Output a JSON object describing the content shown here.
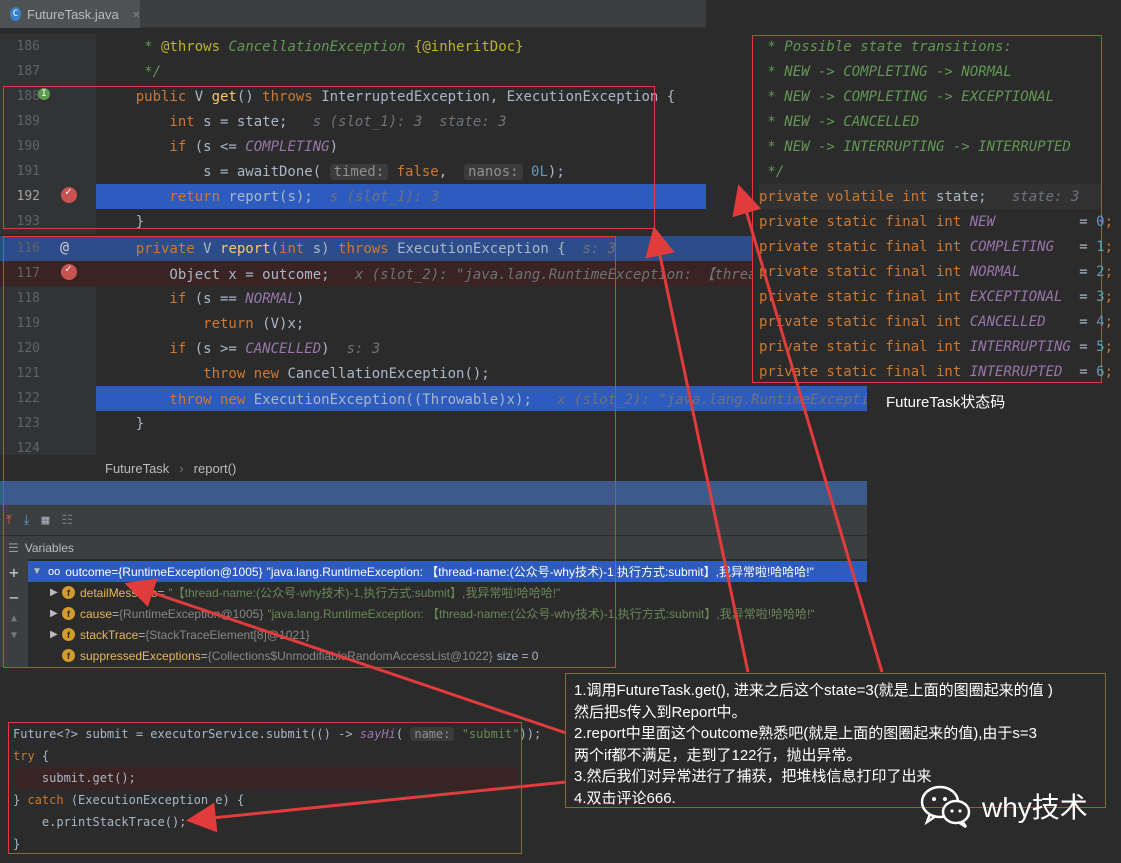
{
  "tab": {
    "filename": "FutureTask.java",
    "icon": "C"
  },
  "pane1": {
    "lines": [
      {
        "n": "186",
        "segs": [
          [
            "cm",
            "     * "
          ],
          [
            "ann",
            "@throws"
          ],
          [
            "cm",
            " CancellationException "
          ],
          [
            "ann",
            "{@inheritDoc}"
          ]
        ]
      },
      {
        "n": "187",
        "segs": [
          [
            "cm",
            "     */"
          ]
        ]
      },
      {
        "n": "188",
        "segs": [
          [
            "kw",
            "    public "
          ],
          [
            "",
            "V "
          ],
          [
            "fn",
            "get"
          ],
          [
            "",
            "() "
          ],
          [
            "kw",
            "throws "
          ],
          [
            "",
            "InterruptedException, ExecutionException {"
          ]
        ]
      },
      {
        "n": "189",
        "segs": [
          [
            "kw",
            "        int "
          ],
          [
            "",
            "s = state;  "
          ],
          [
            "hint",
            " s (slot_1): 3  state: 3"
          ]
        ]
      },
      {
        "n": "190",
        "segs": [
          [
            "kw",
            "        if "
          ],
          [
            "",
            "(s <= "
          ],
          [
            "cst",
            "COMPLETING"
          ],
          [
            "",
            ")"
          ]
        ]
      },
      {
        "n": "191",
        "segs": [
          [
            "",
            "            s = awaitDone( "
          ],
          [
            "hintbox",
            "timed:"
          ],
          [
            "kw",
            " false"
          ],
          [
            "",
            ",  "
          ],
          [
            "hintbox",
            "nanos:"
          ],
          [
            "num",
            " 0L"
          ],
          [
            "",
            ");"
          ]
        ]
      },
      {
        "n": "192",
        "segs": [
          [
            "kw",
            "        return "
          ],
          [
            "",
            "report(s);  "
          ],
          [
            "hint",
            "s (slot_1): 3"
          ]
        ]
      },
      {
        "n": "193",
        "segs": [
          [
            "",
            "    }"
          ]
        ]
      }
    ]
  },
  "pane2": {
    "lines": [
      {
        "n": "116",
        "segs": [
          [
            "kw",
            "    private "
          ],
          [
            "",
            "V "
          ],
          [
            "fn",
            "report"
          ],
          [
            "",
            "("
          ],
          [
            "kw",
            "int "
          ],
          [
            "",
            "s) "
          ],
          [
            "kw",
            "throws "
          ],
          [
            "",
            "ExecutionException {  "
          ],
          [
            "hint",
            "s: 3"
          ]
        ]
      },
      {
        "n": "117",
        "segs": [
          [
            "",
            "        Object x = outcome;  "
          ],
          [
            "hint",
            " x (slot_2): \"java.lang.RuntimeException: 【thread-na"
          ]
        ]
      },
      {
        "n": "118",
        "segs": [
          [
            "kw",
            "        if "
          ],
          [
            "",
            "(s == "
          ],
          [
            "cst",
            "NORMAL"
          ],
          [
            "",
            ")"
          ]
        ]
      },
      {
        "n": "119",
        "segs": [
          [
            "kw",
            "            return "
          ],
          [
            "",
            "(V)x;"
          ]
        ]
      },
      {
        "n": "120",
        "segs": [
          [
            "kw",
            "        if "
          ],
          [
            "",
            "(s >= "
          ],
          [
            "cst",
            "CANCELLED"
          ],
          [
            "",
            ")  "
          ],
          [
            "hint",
            "s: 3"
          ]
        ]
      },
      {
        "n": "121",
        "segs": [
          [
            "kw",
            "            throw new "
          ],
          [
            "",
            "CancellationException();"
          ]
        ]
      },
      {
        "n": "122",
        "segs": [
          [
            "kw",
            "        throw new "
          ],
          [
            "",
            "ExecutionException((Throwable)x);  "
          ],
          [
            "hint",
            " x (slot_2): \"java.lang.RuntimeException: 【"
          ]
        ]
      },
      {
        "n": "123",
        "segs": [
          [
            "",
            "    }"
          ]
        ]
      },
      {
        "n": "124",
        "segs": []
      }
    ]
  },
  "breadcrumb": {
    "class": "FutureTask",
    "method": "report()"
  },
  "variables": {
    "title": "Variables",
    "rows": [
      {
        "name": "outcome",
        "type": "{RuntimeException@1005}",
        "value": "\"java.lang.RuntimeException: 【thread-name:(公众号-why技术)-1,执行方式:submit】,我异常啦!哈哈哈!\""
      },
      {
        "name": "detailMessage",
        "type": "",
        "value": "\"【thread-name:(公众号-why技术)-1,执行方式:submit】,我异常啦!哈哈哈!\""
      },
      {
        "name": "cause",
        "type": "{RuntimeException@1005}",
        "value": "\"java.lang.RuntimeException: 【thread-name:(公众号-why技术)-1,执行方式:submit】,我异常啦!哈哈哈!\""
      },
      {
        "name": "stackTrace",
        "type": "{StackTraceElement[8]@1021}",
        "value": ""
      },
      {
        "name": "suppressedExceptions",
        "type": "{Collections$UnmodifiableRandomAccessList@1022}",
        "value": "size = 0"
      }
    ]
  },
  "snippet": {
    "lines": [
      [
        [
          "",
          "Future<?> submit = executorService.submit(() -> "
        ],
        [
          "cst",
          "sayHi"
        ],
        [
          "",
          "( "
        ],
        [
          "hintbox",
          "name:"
        ],
        [
          "str",
          " \"submit\""
        ],
        [
          "",
          "));"
        ]
      ],
      [
        [
          "kw",
          "try "
        ],
        [
          "",
          "{"
        ]
      ],
      [
        [
          "",
          "    submit.get();"
        ]
      ],
      [
        [
          "",
          "} "
        ],
        [
          "kw",
          "catch "
        ],
        [
          "",
          "(ExecutionException e) {"
        ]
      ],
      [
        [
          "",
          "    e.printStackTrace();"
        ]
      ],
      [
        [
          "",
          "}"
        ]
      ]
    ]
  },
  "state_panel": {
    "lines": [
      [
        [
          "cm",
          " * Possible state transitions:"
        ]
      ],
      [
        [
          "cm",
          " * NEW -> COMPLETING -> NORMAL"
        ]
      ],
      [
        [
          "cm",
          " * NEW -> COMPLETING -> EXCEPTIONAL"
        ]
      ],
      [
        [
          "cm",
          " * NEW -> CANCELLED"
        ]
      ],
      [
        [
          "cm",
          " * NEW -> INTERRUPTING -> INTERRUPTED"
        ]
      ],
      [
        [
          "cm",
          " */"
        ]
      ],
      [
        [
          "kw",
          "private volatile int "
        ],
        [
          "",
          "state;  "
        ],
        [
          "hint",
          " state: 3"
        ]
      ],
      [
        [
          "kw",
          "private static final int "
        ],
        [
          "cst",
          "NEW"
        ],
        [
          "",
          "          = "
        ],
        [
          "num",
          "0"
        ],
        [
          "kw",
          ";"
        ]
      ],
      [
        [
          "kw",
          "private static final int "
        ],
        [
          "cst",
          "COMPLETING"
        ],
        [
          "",
          "   = "
        ],
        [
          "num",
          "1"
        ],
        [
          "kw",
          ";"
        ]
      ],
      [
        [
          "kw",
          "private static final int "
        ],
        [
          "cst",
          "NORMAL"
        ],
        [
          "",
          "       = "
        ],
        [
          "num",
          "2"
        ],
        [
          "kw",
          ";"
        ]
      ],
      [
        [
          "kw",
          "private static final int "
        ],
        [
          "cst",
          "EXCEPTIONAL"
        ],
        [
          "",
          "  = "
        ],
        [
          "num",
          "3"
        ],
        [
          "kw",
          ";"
        ]
      ],
      [
        [
          "kw",
          "private static final int "
        ],
        [
          "cst",
          "CANCELLED"
        ],
        [
          "",
          "    = "
        ],
        [
          "num",
          "4"
        ],
        [
          "kw",
          ";"
        ]
      ],
      [
        [
          "kw",
          "private static final int "
        ],
        [
          "cst",
          "INTERRUPTING"
        ],
        [
          "",
          " = "
        ],
        [
          "num",
          "5"
        ],
        [
          "kw",
          ";"
        ]
      ],
      [
        [
          "kw",
          "private static final int "
        ],
        [
          "cst",
          "INTERRUPTED"
        ],
        [
          "",
          "  = "
        ],
        [
          "num",
          "6"
        ],
        [
          "kw",
          ";"
        ]
      ]
    ],
    "caption": "FutureTask状态码"
  },
  "note": {
    "lines": [
      "1.调用FutureTask.get(), 进来之后这个state=3(就是上面的图圈起来的值 )",
      "然后把s传入到Report中。",
      "2.report中里面这个outcome熟悉吧(就是上面的图圈起来的值),由于s=3",
      "两个if都不满足，走到了122行，抛出异常。",
      "3.然后我们对异常进行了捕获，把堆栈信息打印了出来",
      "4.双击评论666."
    ]
  },
  "watermark": {
    "text": "why技术"
  },
  "colors": {
    "annotation_red": "#e23b3b",
    "selection_blue": "#2d5bbe"
  }
}
